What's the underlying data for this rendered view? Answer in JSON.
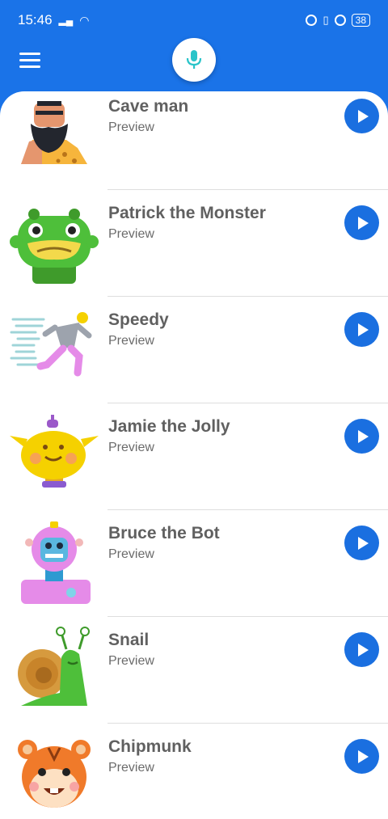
{
  "status_bar": {
    "time": "15:46",
    "battery": "38"
  },
  "header": {
    "menu_icon": "hamburger-menu-icon",
    "mic_icon": "microphone-icon"
  },
  "colors": {
    "primary": "#1a73e8",
    "play_button": "#1a6fe0",
    "mic": "#29c4c9"
  },
  "voices": [
    {
      "name": "Cave man",
      "subtitle": "Preview",
      "avatar": "caveman-avatar"
    },
    {
      "name": "Patrick the Monster",
      "subtitle": "Preview",
      "avatar": "green-monster-avatar"
    },
    {
      "name": "Speedy",
      "subtitle": "Preview",
      "avatar": "running-figure-avatar"
    },
    {
      "name": "Jamie the Jolly",
      "subtitle": "Preview",
      "avatar": "yellow-jolly-avatar"
    },
    {
      "name": "Bruce the Bot",
      "subtitle": "Preview",
      "avatar": "robot-avatar"
    },
    {
      "name": "Snail",
      "subtitle": "Preview",
      "avatar": "snail-avatar"
    },
    {
      "name": "Chipmunk",
      "subtitle": "Preview",
      "avatar": "chipmunk-avatar"
    }
  ]
}
